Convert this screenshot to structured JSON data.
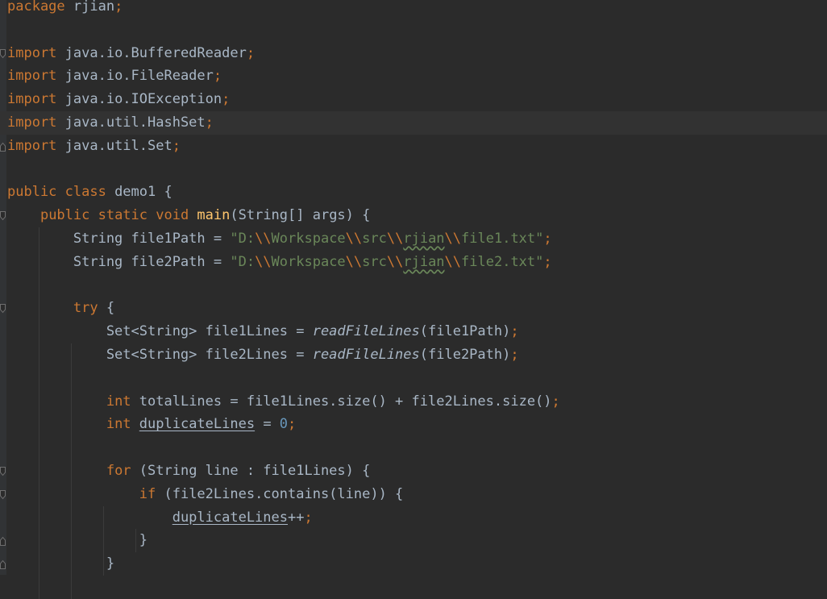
{
  "editor": {
    "language": "java",
    "current_line": 5,
    "lines": [
      [
        {
          "t": "package ",
          "c": "kw"
        },
        {
          "t": "rjian"
        },
        {
          "t": ";",
          "c": "punc"
        }
      ],
      [],
      [
        {
          "t": "import ",
          "c": "kw"
        },
        {
          "t": "java.io.BufferedReader"
        },
        {
          "t": ";",
          "c": "punc"
        }
      ],
      [
        {
          "t": "import ",
          "c": "kw"
        },
        {
          "t": "java.io.FileReader"
        },
        {
          "t": ";",
          "c": "punc"
        }
      ],
      [
        {
          "t": "import ",
          "c": "kw"
        },
        {
          "t": "java.io.IOException"
        },
        {
          "t": ";",
          "c": "punc"
        }
      ],
      [
        {
          "t": "import ",
          "c": "kw"
        },
        {
          "t": "java.util.HashSet"
        },
        {
          "t": ";",
          "c": "punc"
        }
      ],
      [
        {
          "t": "import ",
          "c": "kw"
        },
        {
          "t": "java.util.Set"
        },
        {
          "t": ";",
          "c": "punc"
        }
      ],
      [],
      [
        {
          "t": "public class ",
          "c": "kw"
        },
        {
          "t": "demo1 {"
        }
      ],
      [
        {
          "t": "    "
        },
        {
          "t": "public static void ",
          "c": "kw"
        },
        {
          "t": "main",
          "c": "fn"
        },
        {
          "t": "(String[] args) {"
        }
      ],
      [
        {
          "t": "        String file1Path = "
        },
        {
          "t": "\"D:",
          "c": "str"
        },
        {
          "t": "\\\\",
          "c": "punc"
        },
        {
          "t": "Workspace",
          "c": "str"
        },
        {
          "t": "\\\\",
          "c": "punc"
        },
        {
          "t": "src",
          "c": "str"
        },
        {
          "t": "\\\\",
          "c": "punc"
        },
        {
          "t": "rjian",
          "c": "str typo"
        },
        {
          "t": "\\\\",
          "c": "punc"
        },
        {
          "t": "file1.txt\"",
          "c": "str"
        },
        {
          "t": ";",
          "c": "punc"
        }
      ],
      [
        {
          "t": "        String file2Path = "
        },
        {
          "t": "\"D:",
          "c": "str"
        },
        {
          "t": "\\\\",
          "c": "punc"
        },
        {
          "t": "Workspace",
          "c": "str"
        },
        {
          "t": "\\\\",
          "c": "punc"
        },
        {
          "t": "src",
          "c": "str"
        },
        {
          "t": "\\\\",
          "c": "punc"
        },
        {
          "t": "rjian",
          "c": "str typo"
        },
        {
          "t": "\\\\",
          "c": "punc"
        },
        {
          "t": "file2.txt\"",
          "c": "str"
        },
        {
          "t": ";",
          "c": "punc"
        }
      ],
      [],
      [
        {
          "t": "        "
        },
        {
          "t": "try ",
          "c": "kw"
        },
        {
          "t": "{"
        }
      ],
      [
        {
          "t": "            Set<String> file1Lines = "
        },
        {
          "t": "readFileLines",
          "c": "it"
        },
        {
          "t": "(file1Path)"
        },
        {
          "t": ";",
          "c": "punc"
        }
      ],
      [
        {
          "t": "            Set<String> file2Lines = "
        },
        {
          "t": "readFileLines",
          "c": "it"
        },
        {
          "t": "(file2Path)"
        },
        {
          "t": ";",
          "c": "punc"
        }
      ],
      [],
      [
        {
          "t": "            "
        },
        {
          "t": "int ",
          "c": "kw"
        },
        {
          "t": "totalLines = file1Lines.size() + file2Lines.size()"
        },
        {
          "t": ";",
          "c": "punc"
        }
      ],
      [
        {
          "t": "            "
        },
        {
          "t": "int ",
          "c": "kw"
        },
        {
          "t": "duplicateLines",
          "c": "ul"
        },
        {
          "t": " = "
        },
        {
          "t": "0",
          "c": "num"
        },
        {
          "t": ";",
          "c": "punc"
        }
      ],
      [],
      [
        {
          "t": "            "
        },
        {
          "t": "for ",
          "c": "kw"
        },
        {
          "t": "(String line : file1Lines) {"
        }
      ],
      [
        {
          "t": "                "
        },
        {
          "t": "if ",
          "c": "kw"
        },
        {
          "t": "(file2Lines.contains(line)) {"
        }
      ],
      [
        {
          "t": "                    "
        },
        {
          "t": "duplicateLines",
          "c": "ul"
        },
        {
          "t": "++"
        },
        {
          "t": ";",
          "c": "punc"
        }
      ],
      [
        {
          "t": "                }"
        }
      ],
      [
        {
          "t": "            }"
        }
      ]
    ]
  }
}
